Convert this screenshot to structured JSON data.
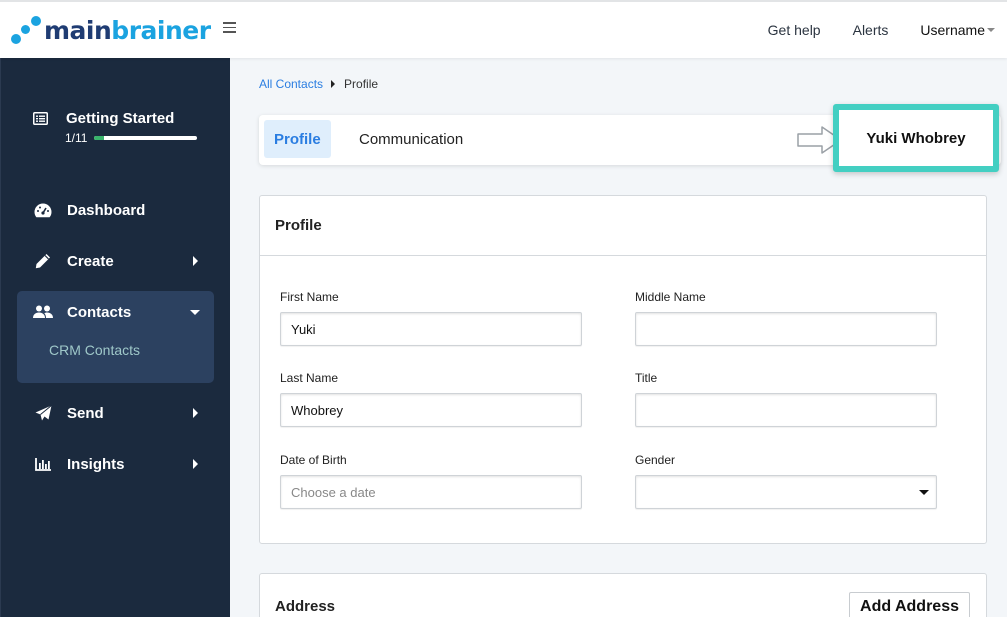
{
  "header": {
    "logo": {
      "main": "main",
      "brainer": "brainer"
    },
    "nav": {
      "help": "Get help",
      "alerts": "Alerts",
      "username": "Username"
    }
  },
  "sidebar": {
    "getting_started": {
      "label": "Getting Started",
      "count": "1/11",
      "progress": 0.09
    },
    "items": [
      {
        "label": "Dashboard",
        "icon": "dashboard-icon"
      },
      {
        "label": "Create",
        "icon": "pencil-icon"
      },
      {
        "label": "Contacts",
        "icon": "users-icon",
        "expanded": true,
        "children": [
          {
            "label": "CRM Contacts"
          }
        ]
      },
      {
        "label": "Send",
        "icon": "paper-plane-icon"
      },
      {
        "label": "Insights",
        "icon": "bar-chart-icon"
      }
    ]
  },
  "breadcrumb": {
    "parent": "All Contacts",
    "current": "Profile"
  },
  "tabs": [
    {
      "label": "Profile",
      "active": true
    },
    {
      "label": "Communication",
      "active": false
    }
  ],
  "contact_name": "Yuki Whobrey",
  "colors": {
    "accent": "#2a7de1",
    "highlight": "#43cfc2",
    "sidebar": "#1b2a3e",
    "progress": "#39b36b"
  },
  "profile_card": {
    "title": "Profile",
    "fields": {
      "first_name": {
        "label": "First Name",
        "value": "Yuki"
      },
      "middle_name": {
        "label": "Middle Name",
        "value": ""
      },
      "last_name": {
        "label": "Last Name",
        "value": "Whobrey"
      },
      "title": {
        "label": "Title",
        "value": ""
      },
      "dob": {
        "label": "Date of Birth",
        "value": "",
        "placeholder": "Choose a date"
      },
      "gender": {
        "label": "Gender",
        "value": ""
      }
    }
  },
  "address_card": {
    "title": "Address",
    "add_button": "Add Address"
  }
}
